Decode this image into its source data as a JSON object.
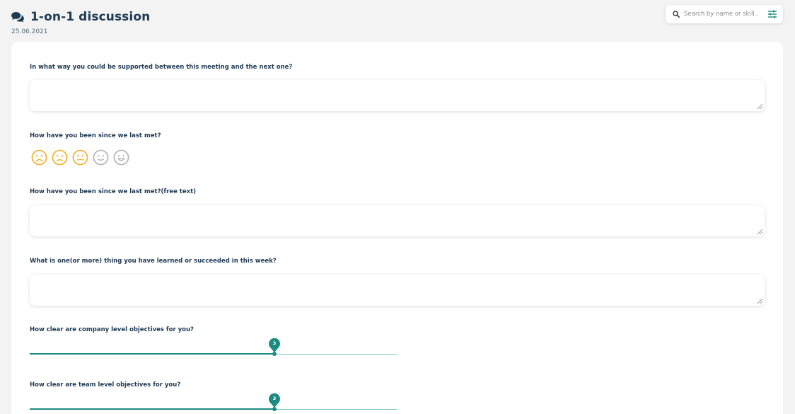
{
  "header": {
    "title": "1-on-1 discussion",
    "date": "25.06.2021",
    "icon": "chat-bubbles-icon"
  },
  "search": {
    "placeholder": "Search by name or skill..",
    "icon": "search-icon",
    "filter_icon": "filter-sliders-icon"
  },
  "colors": {
    "primary": "#1f3b54",
    "accent": "#1c8c83",
    "mood_active": "#f2b233",
    "mood_inactive": "#b5b5b5",
    "background": "#f3f3f3"
  },
  "questions": {
    "q1": {
      "label": "In what way you could be supported between this meeting and the next one?",
      "value": ""
    },
    "q2": {
      "label": "How have you been since we last met?",
      "moods": [
        {
          "name": "very-sad-face-icon",
          "active": true
        },
        {
          "name": "sad-face-icon",
          "active": true
        },
        {
          "name": "neutral-face-icon",
          "active": true
        },
        {
          "name": "smile-face-icon",
          "active": false
        },
        {
          "name": "big-smile-face-icon",
          "active": false
        }
      ],
      "selected_level": 3
    },
    "q3": {
      "label": "How have you been since we last met?(free text)",
      "value": ""
    },
    "q4": {
      "label": "What is one(or more) thing you have learned or succeeded in this week?",
      "value": ""
    },
    "q5": {
      "label": "How clear are company level objectives for you?",
      "value": "3",
      "level": 3,
      "max": 5
    },
    "q6": {
      "label": "How clear are team level objectives for you?",
      "value": "3",
      "level": 3,
      "max": 5
    }
  }
}
